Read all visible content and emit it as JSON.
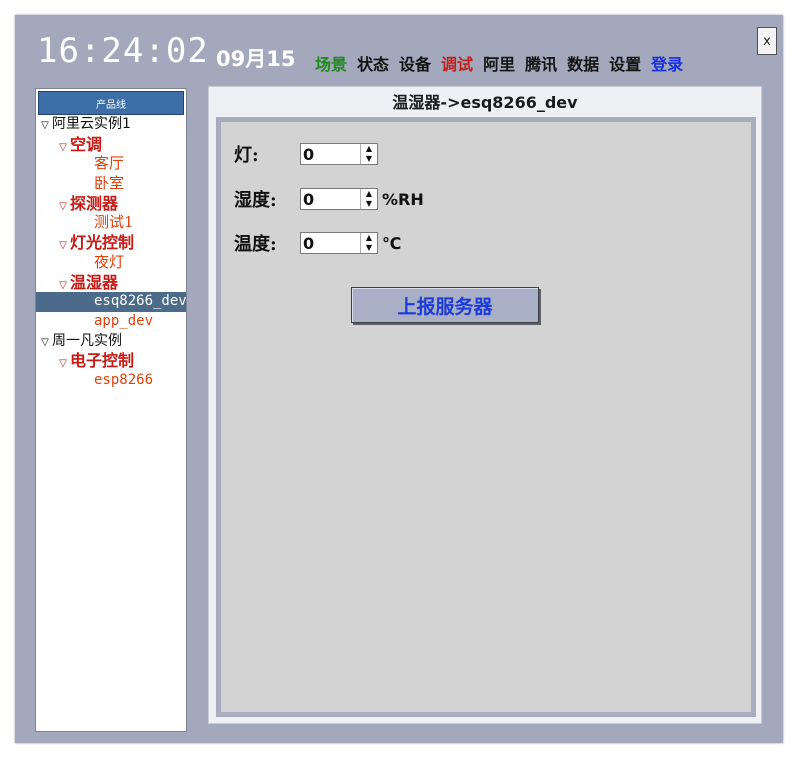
{
  "header": {
    "time": "16:24:02",
    "date": "09月15",
    "close_label": "x",
    "menu": [
      {
        "label": "场景",
        "color": "#1e8a1e"
      },
      {
        "label": "状态",
        "color": "#141414"
      },
      {
        "label": "设备",
        "color": "#141414"
      },
      {
        "label": "调试",
        "color": "#c0201a"
      },
      {
        "label": "阿里",
        "color": "#141414"
      },
      {
        "label": "腾讯",
        "color": "#141414"
      },
      {
        "label": "数据",
        "color": "#141414"
      },
      {
        "label": "设置",
        "color": "#141414"
      },
      {
        "label": "登录",
        "color": "#1830e0"
      }
    ]
  },
  "sidebar": {
    "header": "产品线",
    "tree": [
      {
        "label": "阿里云实例1",
        "level": 0,
        "expanded": true
      },
      {
        "label": "空调",
        "level": 1,
        "expanded": true
      },
      {
        "label": "客厅",
        "level": 2
      },
      {
        "label": "卧室",
        "level": 2
      },
      {
        "label": "探测器",
        "level": 1,
        "expanded": true
      },
      {
        "label": "测试1",
        "level": 2
      },
      {
        "label": "灯光控制",
        "level": 1,
        "expanded": true
      },
      {
        "label": "夜灯",
        "level": 2
      },
      {
        "label": "温湿器",
        "level": 1,
        "expanded": true
      },
      {
        "label": "esq8266_dev",
        "level": 2,
        "selected": true
      },
      {
        "label": "app_dev",
        "level": 2
      },
      {
        "label": "周一凡实例",
        "level": 0,
        "expanded": true
      },
      {
        "label": "电子控制",
        "level": 1,
        "expanded": true
      },
      {
        "label": "esp8266",
        "level": 2
      }
    ],
    "selected_color": "#4c6b8a"
  },
  "content": {
    "title": "温湿器->esq8266_dev",
    "fields": [
      {
        "label": "灯:",
        "value": "0",
        "unit": ""
      },
      {
        "label": "湿度:",
        "value": "0",
        "unit": "%RH"
      },
      {
        "label": "温度:",
        "value": "0",
        "unit": "℃"
      }
    ],
    "report_button": "上报服务器",
    "report_button_color": "#1c3cd8"
  }
}
